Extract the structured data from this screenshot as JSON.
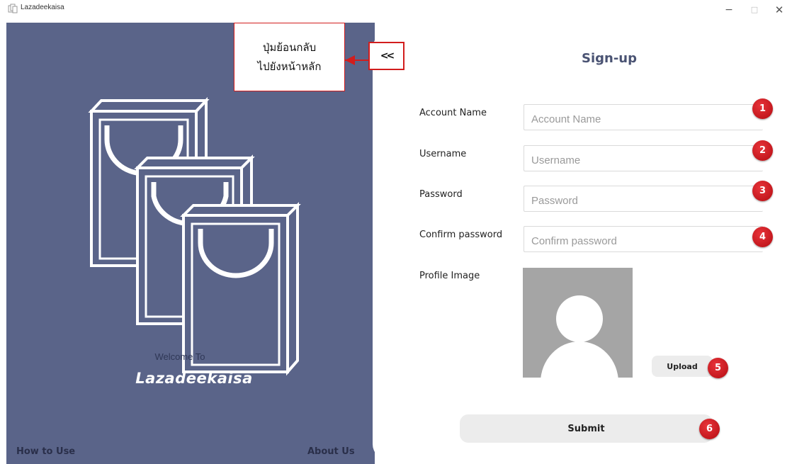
{
  "window": {
    "title": "Lazadeekaisa",
    "minimize": "−",
    "maximize": "□",
    "close": "✕"
  },
  "left_panel": {
    "welcome": "Welcome To",
    "brand": "Lazadeekaisa",
    "footer_left": "How to Use",
    "footer_right": "About Us"
  },
  "annotation": {
    "line1": "ปุ่มย้อนกลับ",
    "line2": "ไปยังหน้าหลัก"
  },
  "form": {
    "back_glyph": "<<",
    "title": "Sign-up",
    "fields": [
      {
        "label": "Account Name",
        "placeholder": "Account Name",
        "value": "",
        "badge": "1"
      },
      {
        "label": "Username",
        "placeholder": "Username",
        "value": "",
        "badge": "2"
      },
      {
        "label": "Password",
        "placeholder": "Password",
        "value": "",
        "badge": "3"
      },
      {
        "label": "Confirm password",
        "placeholder": "Confirm password",
        "value": "",
        "badge": "4"
      }
    ],
    "profile_label": "Profile Image",
    "upload_label": "Upload",
    "upload_badge": "5",
    "submit_label": "Submit",
    "submit_badge": "6"
  },
  "colors": {
    "panel": "#5a6489",
    "title_text": "#4a5373",
    "badge_red": "#d21d1d",
    "placeholder_gray": "#a5a5a5"
  },
  "icons": {
    "back": "double-chevron-left-icon",
    "avatar": "user-silhouette-icon",
    "bags": "shopping-bags-icon"
  }
}
